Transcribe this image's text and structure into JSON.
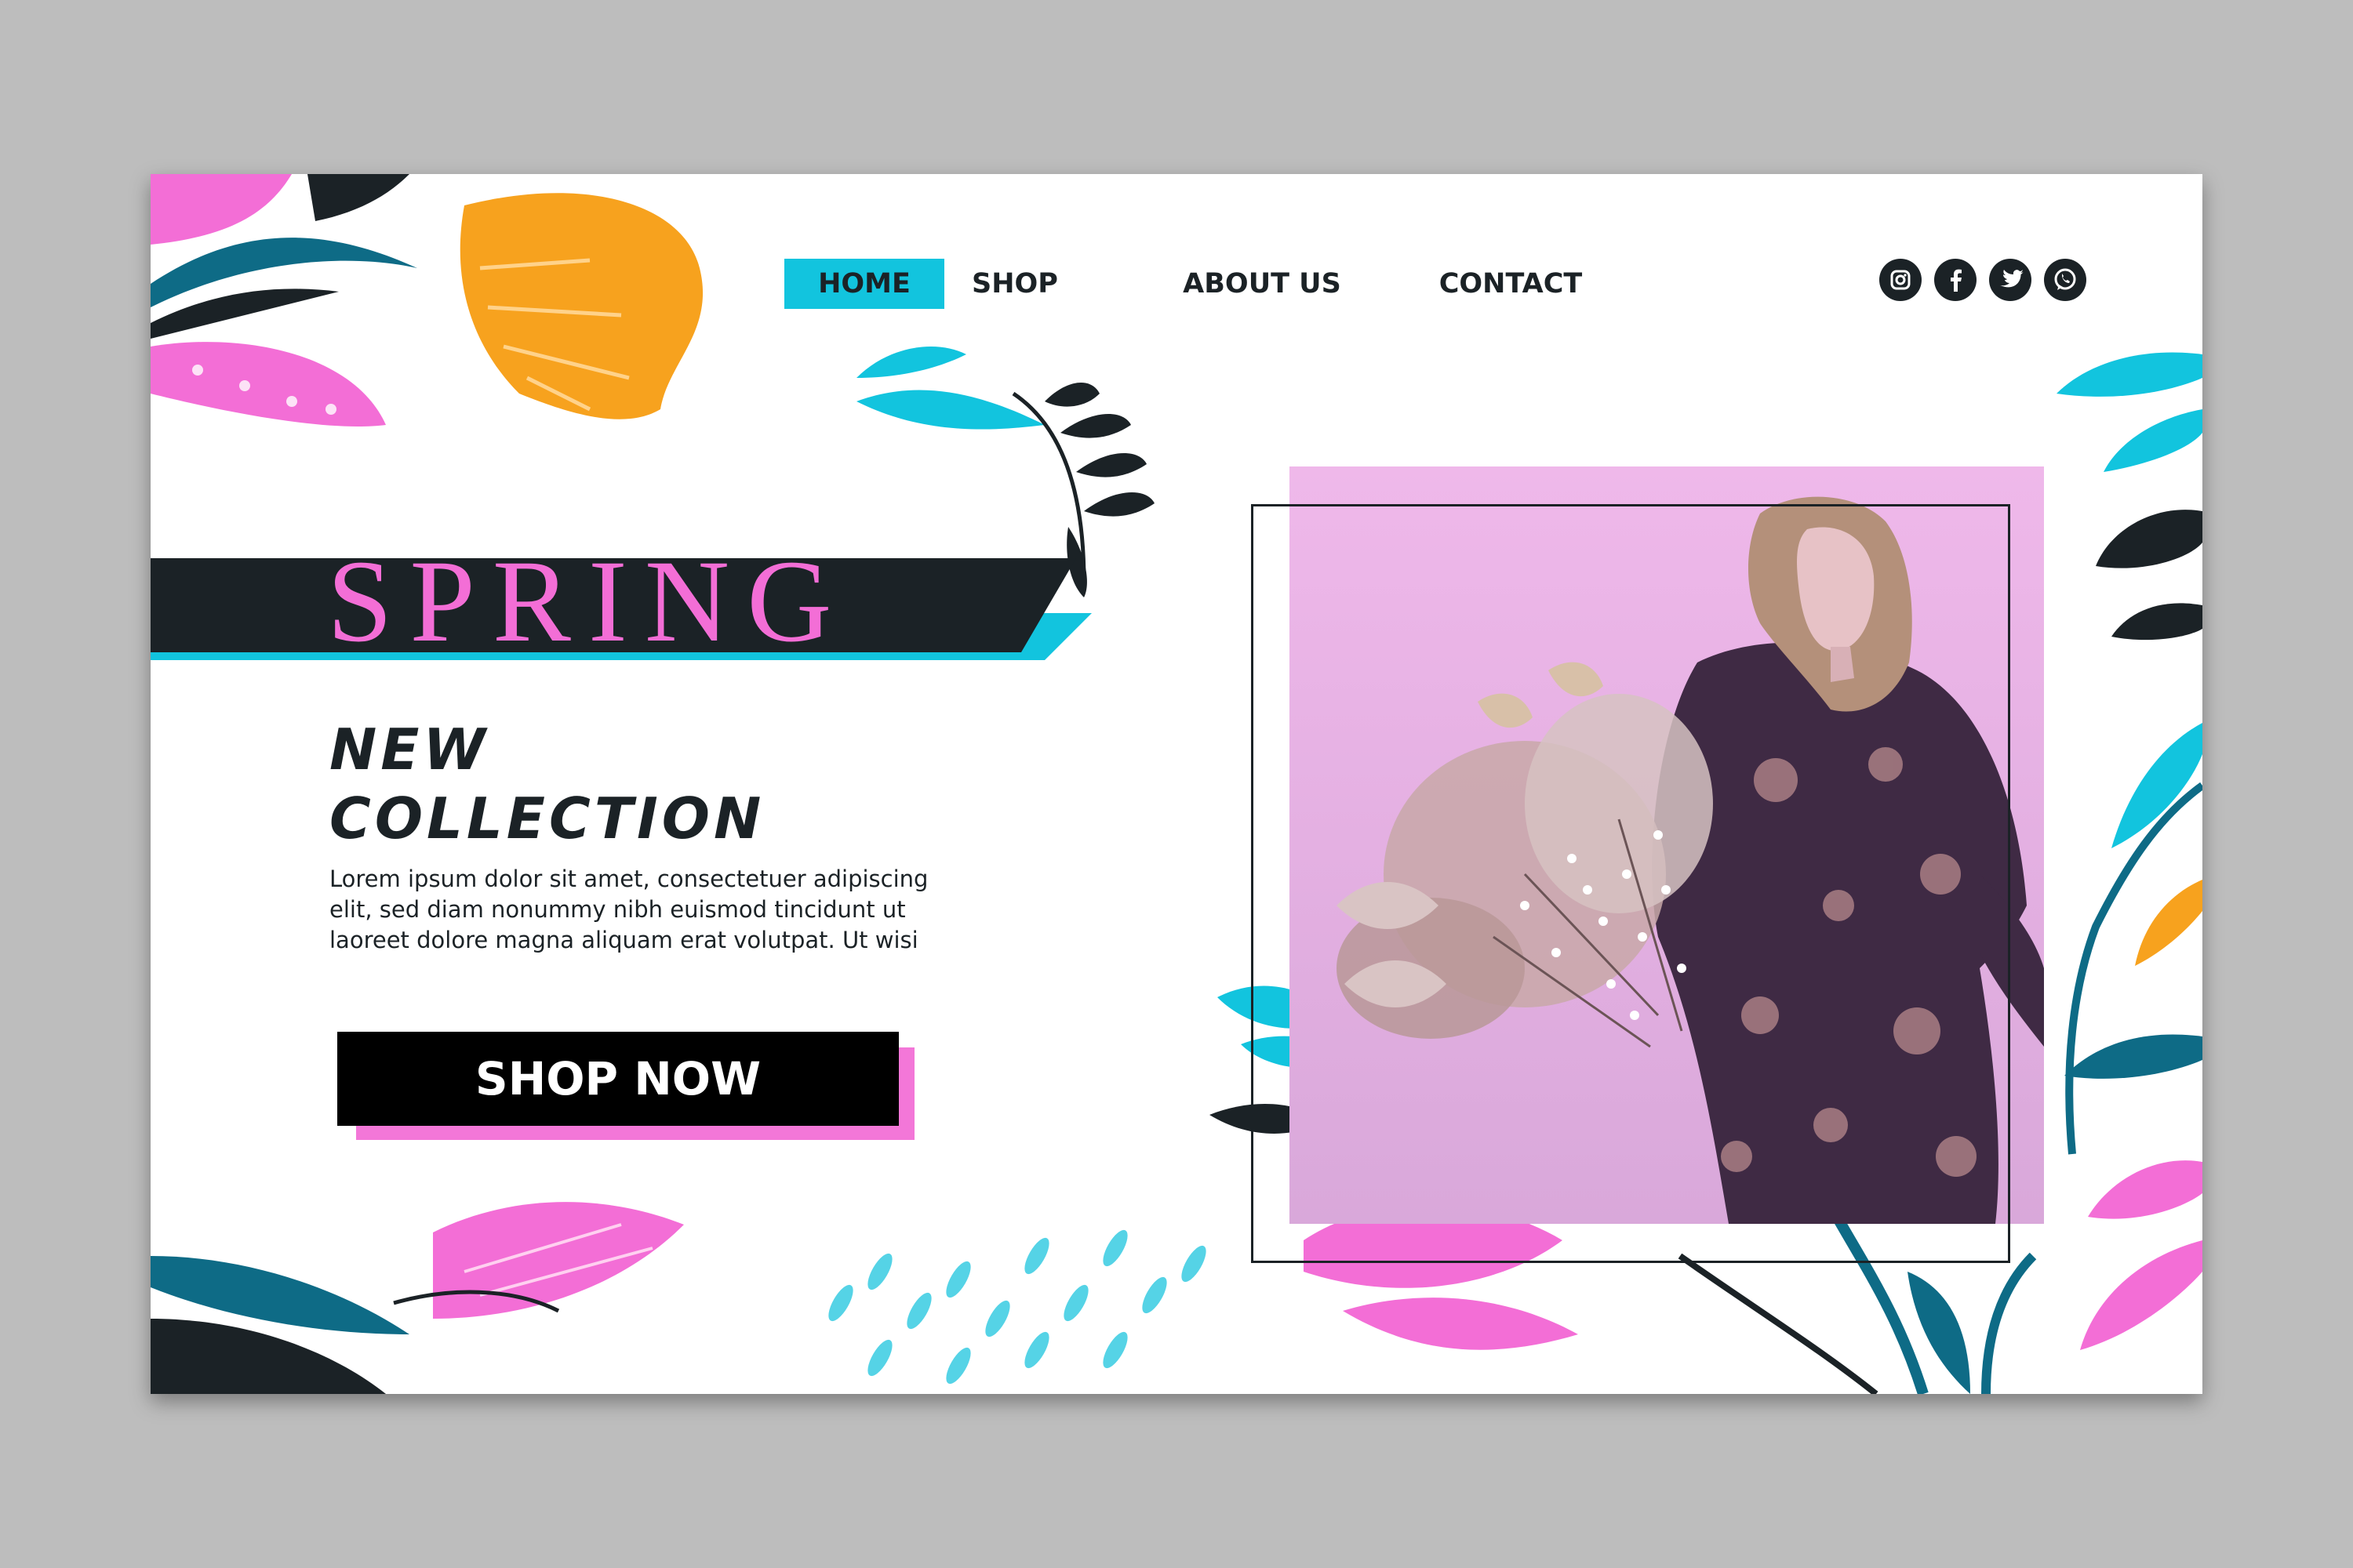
{
  "nav": {
    "items": [
      {
        "label": "HOME",
        "active": true
      },
      {
        "label": "SHOP",
        "active": false
      },
      {
        "label": "ABOUT US",
        "active": false
      },
      {
        "label": "CONTACT",
        "active": false
      }
    ]
  },
  "social": [
    "instagram-icon",
    "facebook-icon",
    "twitter-icon",
    "whatsapp-icon"
  ],
  "hero": {
    "banner_text": "SPRING",
    "headline_line1": "NEW",
    "headline_line2": "COLLECTION",
    "body_line1": "Lorem ipsum dolor sit amet, consectetuer adipiscing",
    "body_line2": "elit, sed diam nonummy nibh euismod tincidunt ut",
    "body_line3": "laoreet dolore magna aliquam erat volutpat. Ut wisi",
    "cta_label": "SHOP NOW"
  },
  "colors": {
    "accent_cyan": "#12c4de",
    "accent_pink": "#f36ed6",
    "accent_orange": "#f7a21e",
    "dark": "#1b2226",
    "teal": "#0e6b86"
  }
}
